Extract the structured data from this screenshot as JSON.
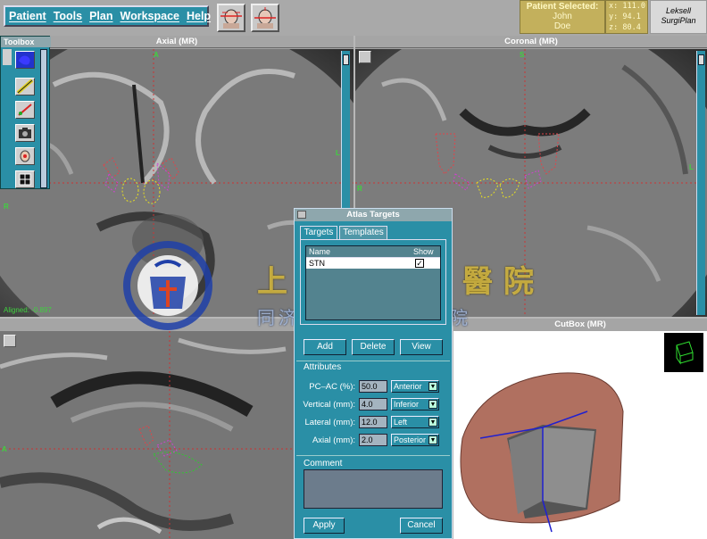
{
  "menu": {
    "items": [
      "Patient",
      "Tools",
      "Plan",
      "Workspace",
      "Help"
    ]
  },
  "patient": {
    "label": "Patient Selected:",
    "first_name": "John",
    "last_name": "Doe"
  },
  "coords": {
    "x": "x: 111.0",
    "y": "y:  94.1",
    "z": "z:  80.4"
  },
  "brand": {
    "line1": "Leksell",
    "line2": "SurgiPlan"
  },
  "toolbox": {
    "title": "Toolbox"
  },
  "views": {
    "axial": {
      "title": "Axial (MR)",
      "status": "Aligned: -0.897",
      "orient_top": "A",
      "orient_right": "L",
      "orient_left": "R"
    },
    "coronal": {
      "title": "Coronal (MR)",
      "orient_top": "S",
      "orient_right": "L",
      "orient_left": "R"
    },
    "sagittal": {
      "orient_left": "A"
    },
    "cutbox": {
      "title": "CutBox (MR)"
    }
  },
  "dialog": {
    "title": "Atlas Targets",
    "tabs": [
      "Targets",
      "Templates"
    ],
    "list_headers": {
      "name": "Name",
      "show": "Show"
    },
    "list_row": {
      "name": "STN",
      "checked": true
    },
    "buttons": {
      "add": "Add",
      "delete": "Delete",
      "view": "View",
      "apply": "Apply",
      "cancel": "Cancel"
    },
    "attributes_label": "Attributes",
    "attributes": [
      {
        "label": "PC–AC (%):",
        "value": "50.0",
        "option": "Anterior"
      },
      {
        "label": "Vertical (mm):",
        "value": "4.0",
        "option": "Inferior"
      },
      {
        "label": "Lateral (mm):",
        "value": "12.0",
        "option": "Left"
      },
      {
        "label": "Axial (mm):",
        "value": "2.0",
        "option": "Posterior"
      }
    ],
    "comment_label": "Comment"
  },
  "watermark": {
    "line1": "上海市東方醫院",
    "line2": "同济大学附属东方医院"
  },
  "colors": {
    "panel_teal": "#2a8fa6",
    "title_gray": "#8ea7ad",
    "target_red": "#e0444a",
    "target_magenta": "#d040d0",
    "target_yellow": "#e8e020",
    "target_green": "#30c830",
    "info_gold": "#c3b05c"
  }
}
